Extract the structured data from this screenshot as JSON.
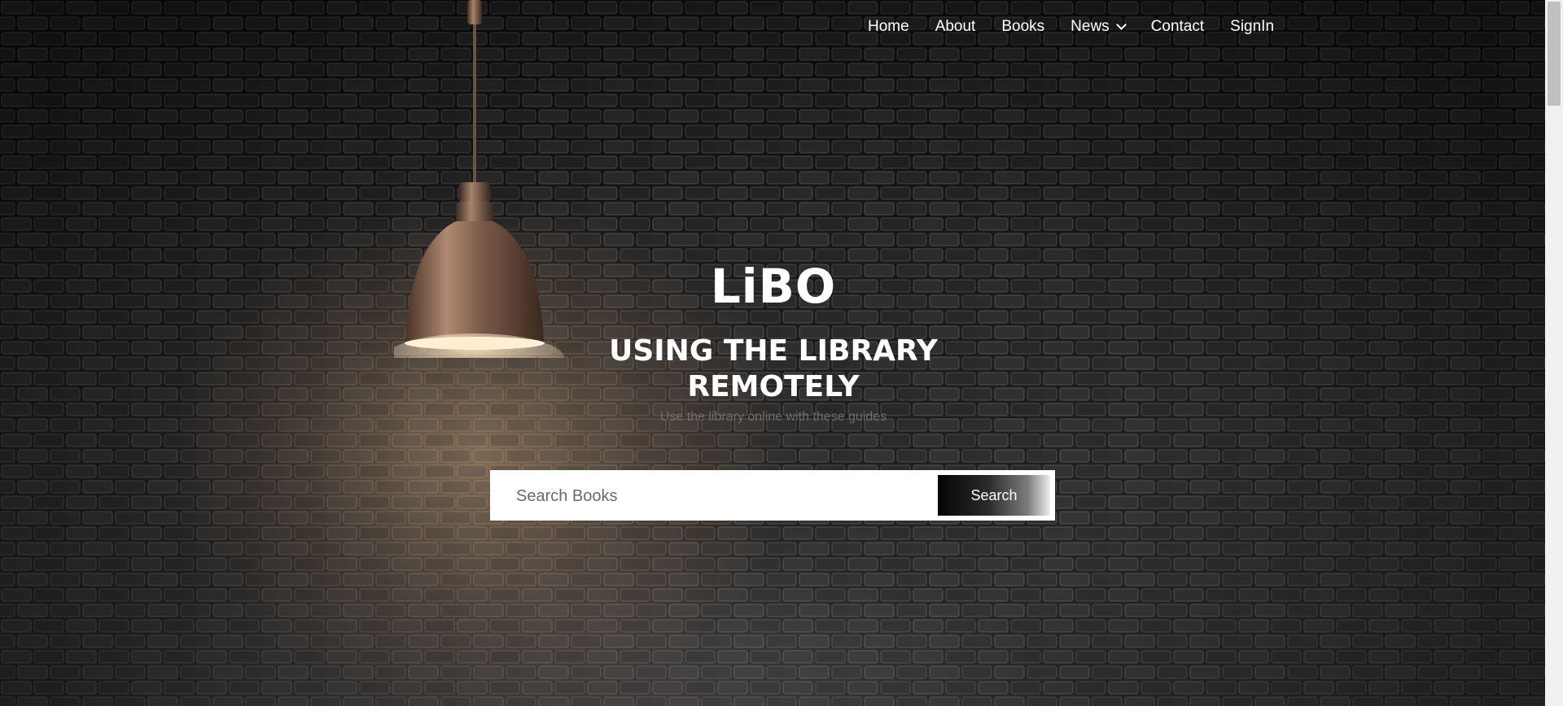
{
  "nav": {
    "items": [
      {
        "label": "Home"
      },
      {
        "label": "About"
      },
      {
        "label": "Books"
      },
      {
        "label": "News"
      },
      {
        "label": "Contact"
      },
      {
        "label": "SignIn"
      }
    ]
  },
  "hero": {
    "brand": "LiBO",
    "headline": "USING THE LIBRARY REMOTELY",
    "subtitle": "Use the library online with these guides"
  },
  "search": {
    "placeholder": "Search Books",
    "button_label": "Search"
  },
  "icons": {
    "news_dropdown": "chevron-down-icon",
    "lamp": "pendant-lamp"
  }
}
